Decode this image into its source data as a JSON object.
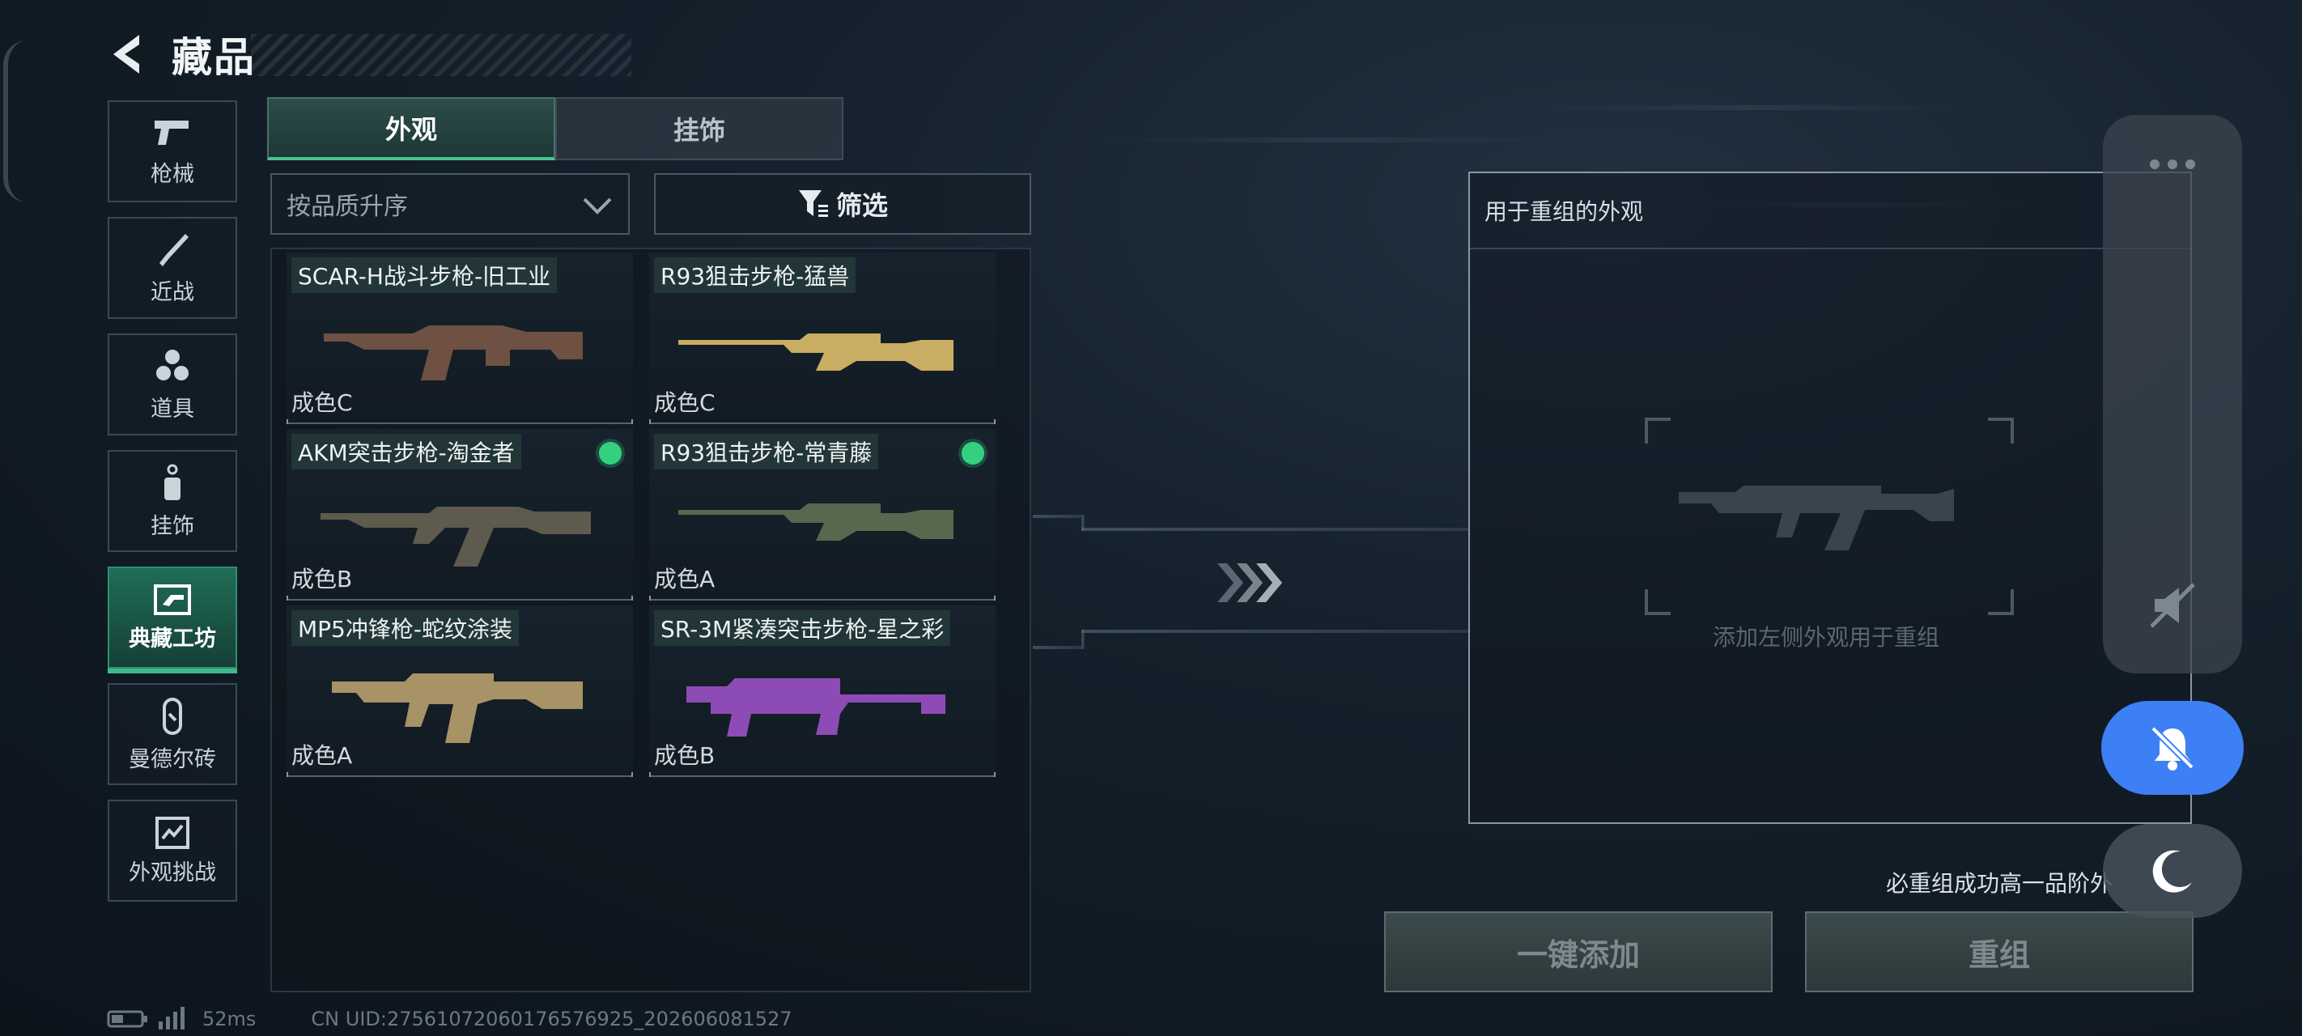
{
  "header": {
    "title": "藏品"
  },
  "nav": [
    {
      "label": "枪械",
      "icon": "pistol-icon",
      "active": false
    },
    {
      "label": "近战",
      "icon": "knife-icon",
      "active": false
    },
    {
      "label": "道具",
      "icon": "items-icon",
      "active": false
    },
    {
      "label": "挂饰",
      "icon": "charm-icon",
      "active": false
    },
    {
      "label": "典藏工坊",
      "icon": "workshop-icon",
      "active": true
    },
    {
      "label": "曼德尔砖",
      "icon": "brick-icon",
      "active": false
    },
    {
      "label": "外观挑战",
      "icon": "challenge-icon",
      "active": false
    }
  ],
  "tabs": [
    {
      "label": "外观",
      "active": true
    },
    {
      "label": "挂饰",
      "active": false
    }
  ],
  "sort": {
    "label": "按品质升序"
  },
  "filter": {
    "label": "筛选"
  },
  "items": [
    {
      "name": "SCAR-H战斗步枪-旧工业",
      "grade": "成色C",
      "selected": false,
      "skin": "#6e5142"
    },
    {
      "name": "R93狙击步枪-猛兽",
      "grade": "成色C",
      "selected": false,
      "skin": "#c8ad62"
    },
    {
      "name": "AKM突击步枪-淘金者",
      "grade": "成色B",
      "selected": true,
      "skin": "#5f5a4e"
    },
    {
      "name": "R93狙击步枪-常青藤",
      "grade": "成色A",
      "selected": true,
      "skin": "#56694e"
    },
    {
      "name": "MP5冲锋枪-蛇纹涂装",
      "grade": "成色A",
      "selected": false,
      "skin": "#a89366"
    },
    {
      "name": "SR-3M紧凑突击步枪-星之彩",
      "grade": "成色B",
      "selected": false,
      "skin": "#8d4bb5"
    }
  ],
  "recombine": {
    "panel_title": "用于重组的外观",
    "hint": "添加左侧外观用于重组",
    "requirement": "必重组成功高一品阶外",
    "add_all": "一键添加",
    "recombine": "重组"
  },
  "status": {
    "latency": "52ms",
    "uid": "CN UID:27561072060176576925_202606081527"
  },
  "colors": {
    "accent": "#3fb989",
    "selected_dot": "#35d07f",
    "bell_button": "#3d7ff5"
  }
}
